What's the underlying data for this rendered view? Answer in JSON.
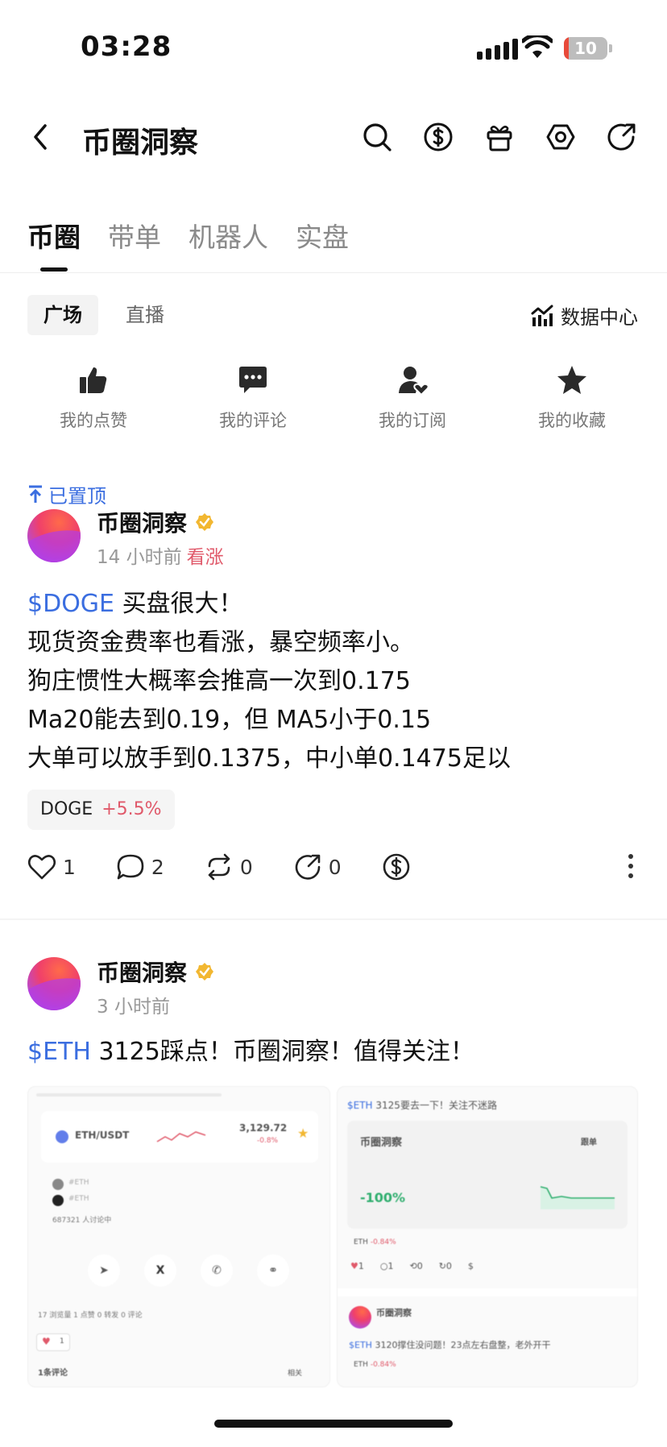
{
  "status_bar": {
    "time": "03:28",
    "battery": "10"
  },
  "nav": {
    "title": "币圈洞察",
    "icons": [
      "back-icon",
      "search-icon",
      "dollar-icon",
      "gift-icon",
      "settings-icon",
      "share-icon"
    ]
  },
  "tabs": [
    {
      "label": "币圈",
      "active": true
    },
    {
      "label": "带单",
      "active": false
    },
    {
      "label": "机器人",
      "active": false
    },
    {
      "label": "实盘",
      "active": false
    }
  ],
  "sub_tabs": [
    {
      "label": "广场",
      "active": true
    },
    {
      "label": "直播",
      "active": false
    }
  ],
  "data_center_label": "数据中心",
  "quick_actions": [
    {
      "label": "我的点赞",
      "icon": "thumbs-up-icon"
    },
    {
      "label": "我的评论",
      "icon": "comment-icon"
    },
    {
      "label": "我的订阅",
      "icon": "subscribe-icon"
    },
    {
      "label": "我的收藏",
      "icon": "star-icon"
    }
  ],
  "post1": {
    "pinned_label": "已置顶",
    "author": "币圈洞察",
    "time": "14 小时前",
    "sentiment": "看涨",
    "tag": "$DOGE",
    "line1": "买盘很大！",
    "line2": "现货资金费率也看涨，暴空频率小。",
    "line3": "狗庄惯性大概率会推高一次到0.175",
    "line4": "Ma20能去到0.19，但 MA5小于0.15",
    "line5": "大单可以放手到0.1375，中小单0.1475足以",
    "coin": "DOGE",
    "coin_change": "+5.5%",
    "likes": "1",
    "comments": "2",
    "reposts": "0",
    "shares": "0"
  },
  "post2": {
    "author": "币圈洞察",
    "time": "3 小时前",
    "tag": "$ETH",
    "text": "3125踩点！币圈洞察！值得关注！",
    "img1": {
      "pair": "ETH/USDT",
      "price": "3,129.72",
      "change": "-0.8%",
      "eth1": "#ETH",
      "eth2": "#ETH",
      "joined": "687321 人讨论中",
      "stats_line": "17 浏览量  1 点赞  0 转发  0 评论",
      "like_count": "1",
      "comments": "1条评论",
      "related": "相关"
    },
    "img2": {
      "tag": "$ETH",
      "header": "3125要去一下！关注不迷路",
      "author": "币圈洞察",
      "follow": "跟单",
      "pnl": "-100%",
      "coin": "ETH",
      "change": "-0.84%",
      "like": "1",
      "comment": "1",
      "repost": "0",
      "share": "0",
      "author2": "币圈洞察",
      "line2_tag": "$ETH",
      "line2": "3120撑住没问题！23点左右盘整，老外开干",
      "coin2": "ETH",
      "change2": "-0.84%"
    }
  },
  "colors": {
    "accent_blue": "#3b6ee0",
    "bull_red": "#e0596a",
    "pnl_green": "#2fae6e"
  }
}
